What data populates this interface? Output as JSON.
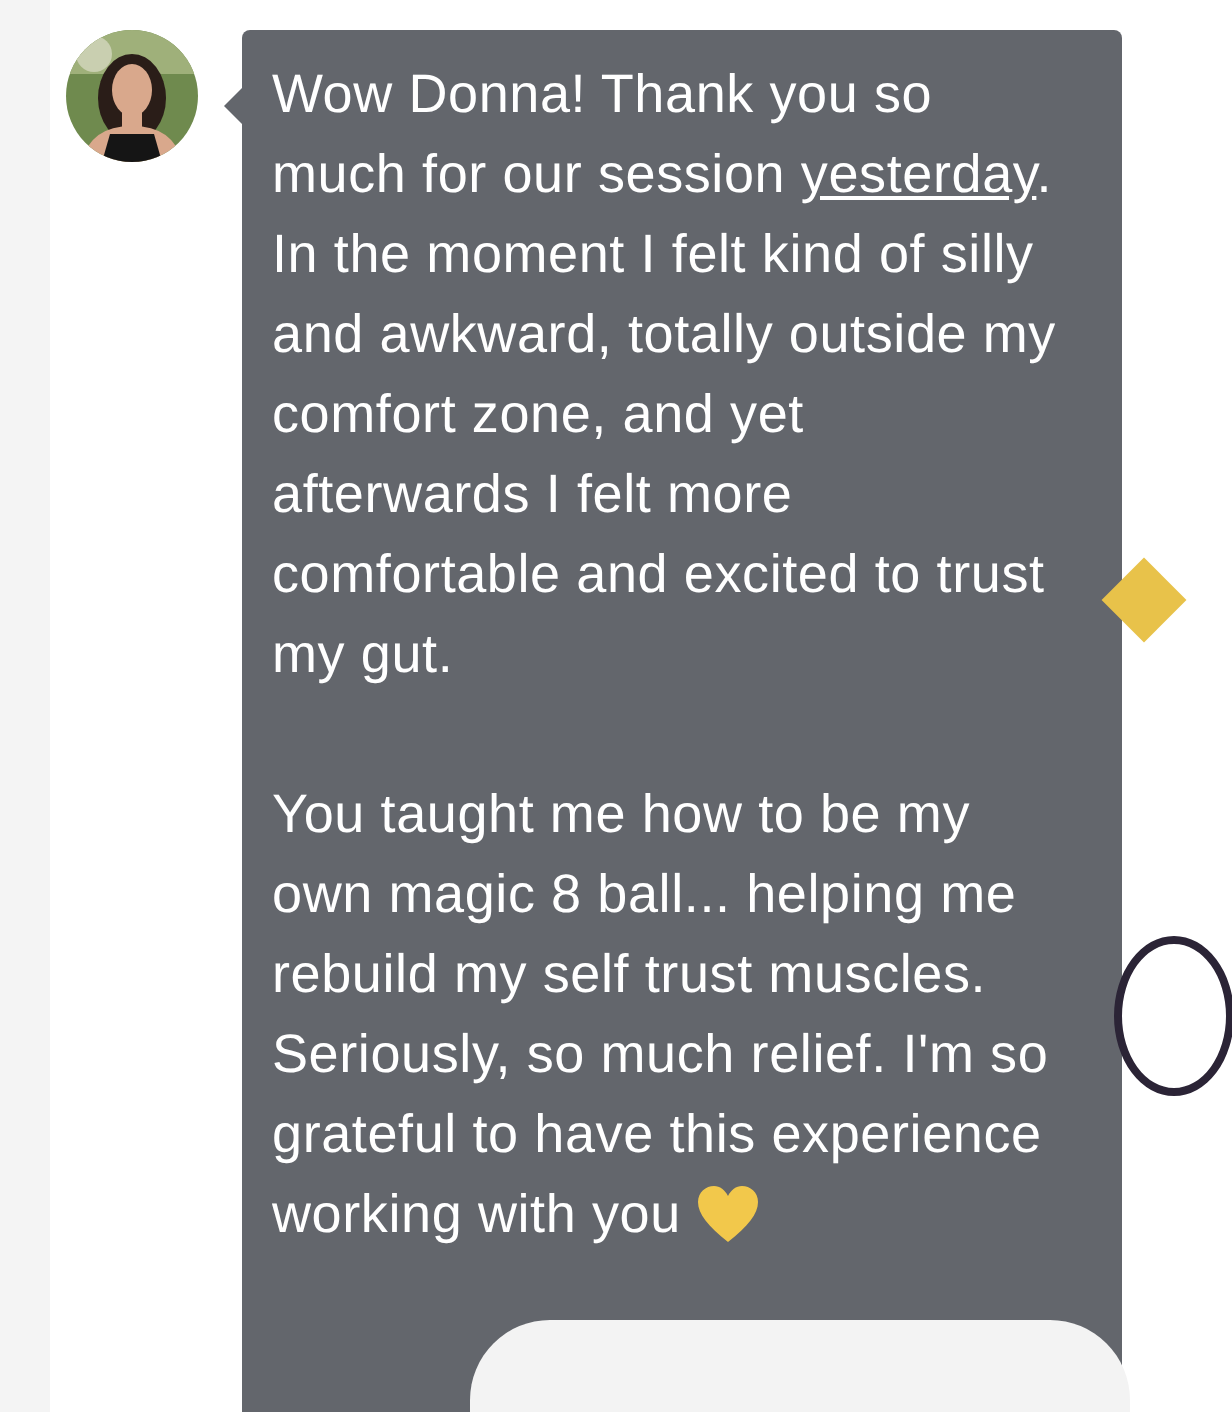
{
  "message": {
    "sender_avatar": {
      "kind": "picture"
    },
    "paragraphs": [
      [
        {
          "text": "Wow Donna! Thank you so much for our session "
        },
        {
          "text": "yesterday",
          "underline": true
        },
        {
          "text": ". In the moment I felt kind of silly and awkward, totally outside my comfort zone, and yet afterwards I felt more comfortable and excited to trust my gut."
        }
      ],
      [
        {
          "text": "You taught me how to be my own magic 8 ball...  helping me rebuild my self trust muscles. Seriously, so much relief. I'm so grateful to have this experience working with you"
        }
      ]
    ],
    "ends_with_heart": true
  }
}
